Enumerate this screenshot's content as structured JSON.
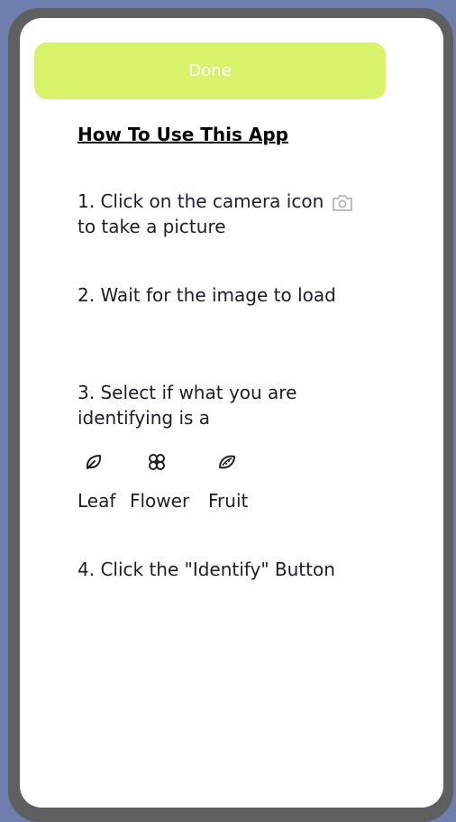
{
  "done_button": {
    "label": "Done"
  },
  "title": "How To Use This App",
  "steps": {
    "step1_text": "1. Click on the camera icon",
    "step1_line2": "to take a picture",
    "step2": "2. Wait for the image to load",
    "step3_line1": "3. Select if what you are",
    "step3_line2": "identifying is a",
    "step4": "4. Click the \"Identify\" Button"
  },
  "types": [
    {
      "label": "Leaf",
      "icon": "leaf-icon"
    },
    {
      "label": "Flower",
      "icon": "flower-icon"
    },
    {
      "label": "Fruit",
      "icon": "fruit-icon"
    }
  ],
  "colors": {
    "background": "#6f7fad",
    "frame": "#5f5f61",
    "done_button": "#d8f26a"
  }
}
